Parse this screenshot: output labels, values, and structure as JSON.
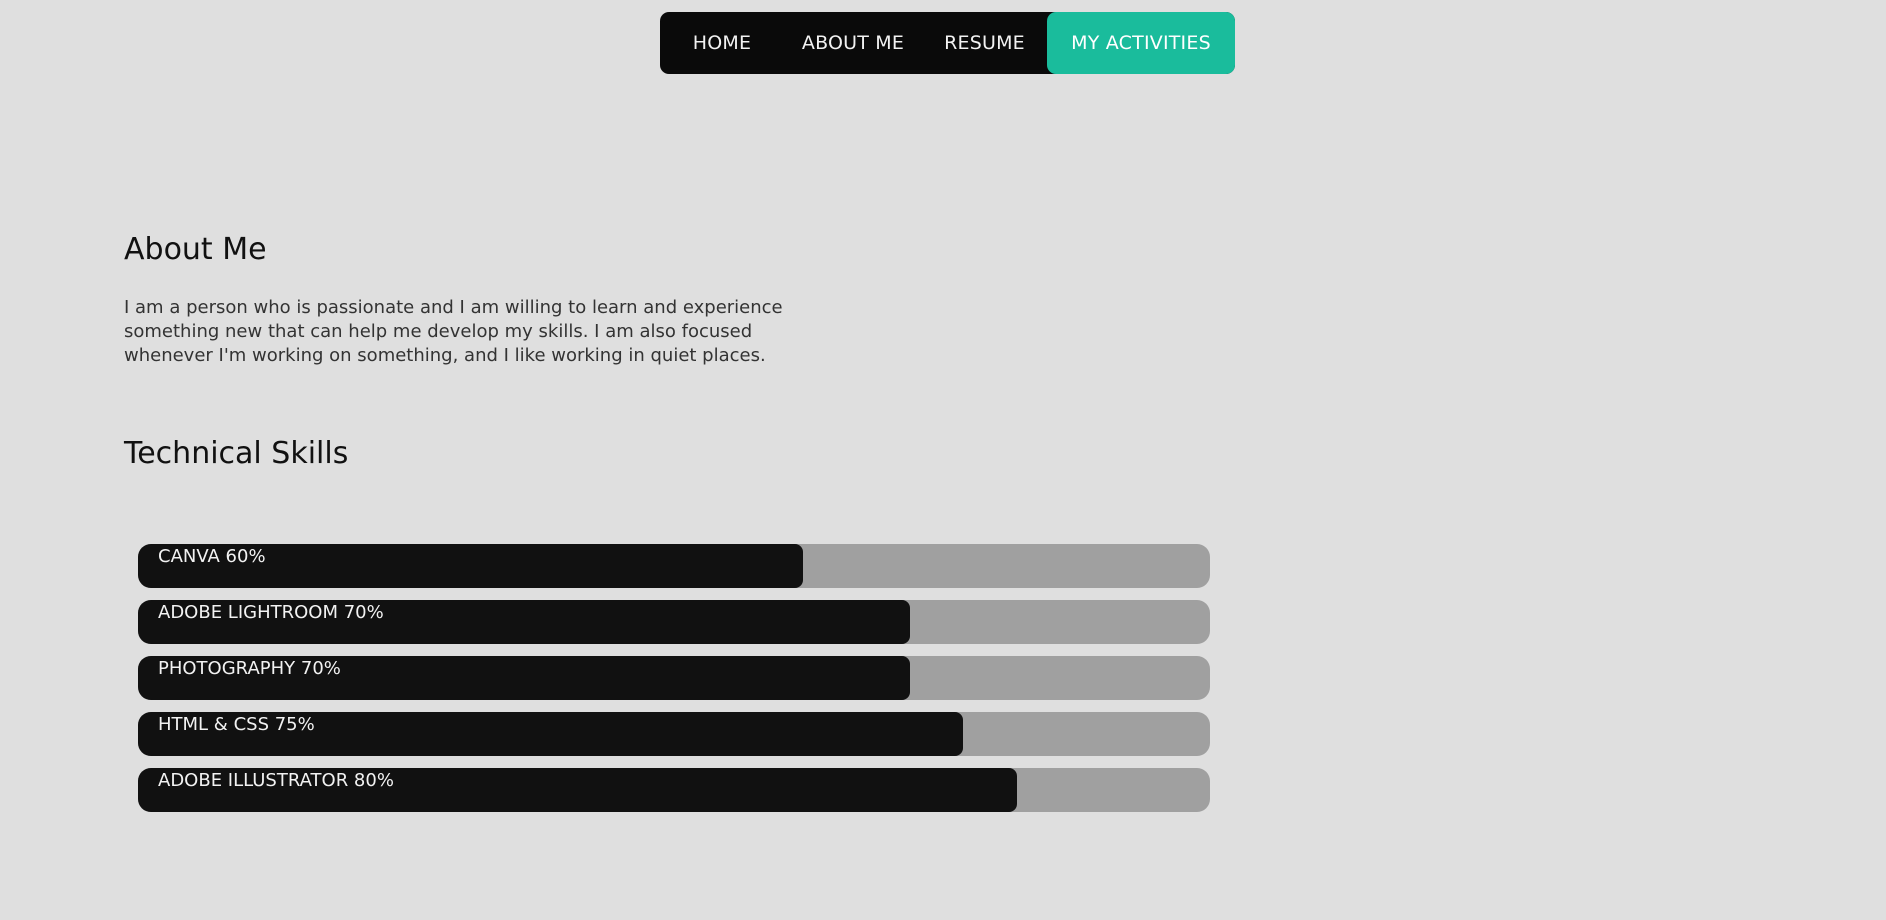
{
  "nav": {
    "items": [
      {
        "label": "HOME"
      },
      {
        "label": "ABOUT ME"
      },
      {
        "label": "RESUME"
      },
      {
        "label": "MY ACTIVITIES",
        "active": true
      }
    ],
    "active_color": "#1abc9c",
    "bar_color": "#0a0a0a"
  },
  "about": {
    "title": "About Me",
    "text": "I am a person who is passionate and I am willing to learn and experience something new that can help me develop my skills. I am also focused whenever I'm working on something, and I like working in quiet places."
  },
  "skills": {
    "title": "Technical Skills",
    "items": [
      {
        "label": "CANVA 60%",
        "value": 0.62
      },
      {
        "label": "ADOBE LIGHTROOM 70%",
        "value": 0.72
      },
      {
        "label": "PHOTOGRAPHY 70%",
        "value": 0.72
      },
      {
        "label": "HTML & CSS 75%",
        "value": 0.77
      },
      {
        "label": "ADOBE ILLUSTRATOR 80%",
        "value": 0.82
      }
    ],
    "fill_color": "#111111",
    "track_color": "#a0a0a0"
  }
}
